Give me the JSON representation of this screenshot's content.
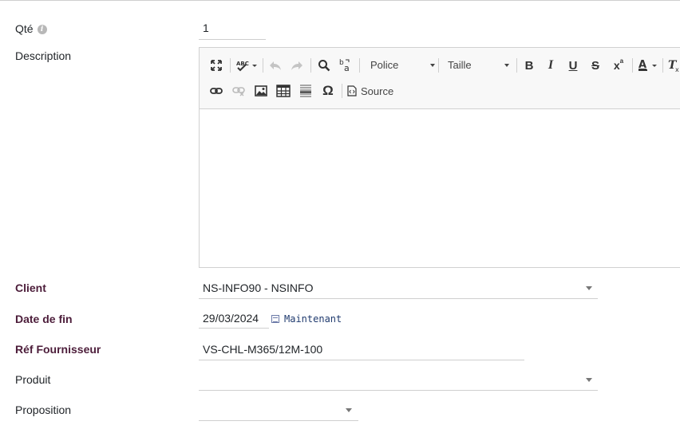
{
  "form": {
    "qty": {
      "label": "Qté",
      "value": "1"
    },
    "description": {
      "label": "Description"
    },
    "client": {
      "label": "Client",
      "value": "NS-INFO90 - NSINFO"
    },
    "end_date": {
      "label": "Date de fin",
      "value": "29/03/2024",
      "now_label": "Maintenant"
    },
    "supplier_ref": {
      "label": "Réf Fournisseur",
      "value": "VS-CHL-M365/12M-100"
    },
    "product": {
      "label": "Produit",
      "value": ""
    },
    "proposal": {
      "label": "Proposition",
      "value": ""
    }
  },
  "editor": {
    "font_combo": "Police",
    "size_combo": "Taille",
    "source_label": "Source",
    "icons": [
      "maximize-icon",
      "spellcheck-icon",
      "undo-icon",
      "redo-icon",
      "find-icon",
      "replace-icon",
      "bold-icon",
      "italic-icon",
      "underline-icon",
      "strike-icon",
      "superscript-icon",
      "text-color-icon",
      "remove-format-icon",
      "link-icon",
      "unlink-icon",
      "image-icon",
      "table-icon",
      "horizontal-rule-icon",
      "special-char-icon",
      "source-icon"
    ]
  },
  "colors": {
    "required_label": "#4c1d3a",
    "link": "#1f3a6e",
    "border": "#cfcfcf"
  }
}
